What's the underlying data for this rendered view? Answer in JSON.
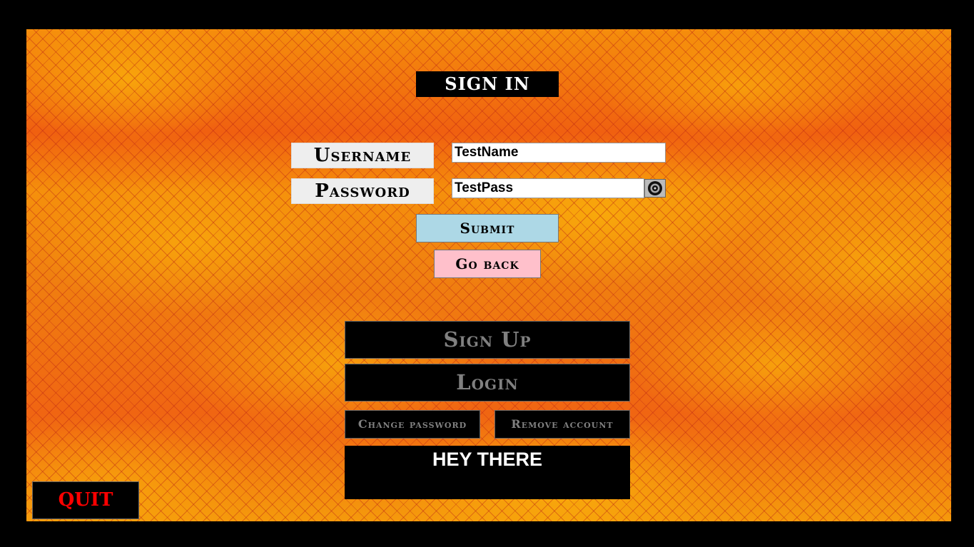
{
  "title": "SIGN IN",
  "form": {
    "username_label": "Username",
    "username_value": "TestName",
    "password_label": "Password",
    "password_value": "TestPass",
    "toggle_icon": "eye-icon",
    "submit_label": "Submit",
    "goback_label": "Go back"
  },
  "menu": {
    "signup_label": "Sign Up",
    "login_label": "Login",
    "change_password_label": "Change password",
    "remove_account_label": "Remove account"
  },
  "message": "HEY THERE",
  "quit_label": "QUIT",
  "colors": {
    "background": "#f57f0a",
    "submit": "#add8e6",
    "goback": "#ffc0cb",
    "quit_text": "#ff0000",
    "disabled_text": "#808080"
  }
}
